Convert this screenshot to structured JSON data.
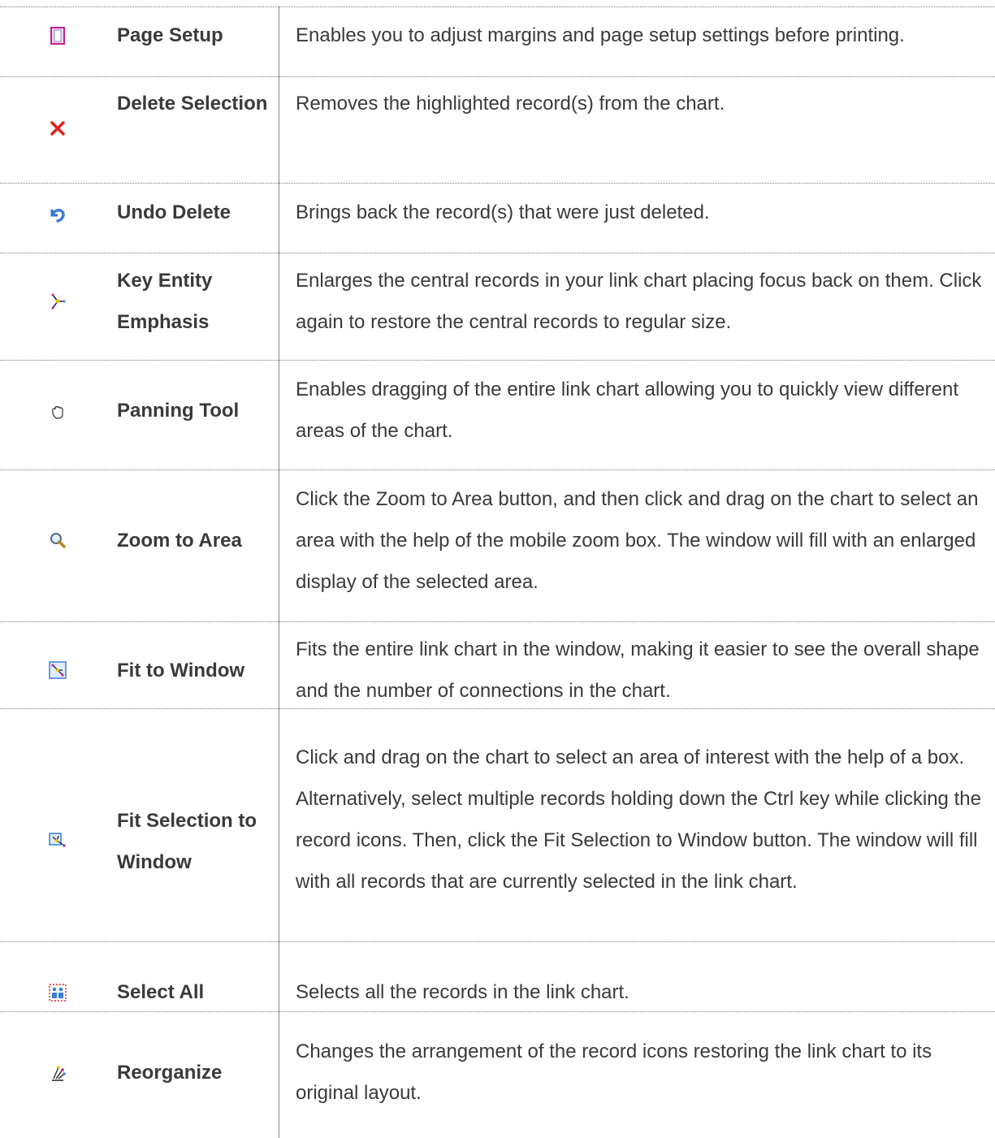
{
  "rows": [
    {
      "icon": "page-setup-icon",
      "name": "Page Setup",
      "desc": "Enables you to adjust margins and page setup settings before printing."
    },
    {
      "icon": "delete-x-icon",
      "name": "Delete Selection",
      "desc": "Removes the highlighted record(s) from the chart."
    },
    {
      "icon": "undo-arrow-icon",
      "name": "Undo Delete",
      "desc": "Brings back the record(s) that were just deleted."
    },
    {
      "icon": "key-entity-icon",
      "name": "Key Entity Emphasis",
      "desc": "Enlarges the central records in your link chart placing focus back on them. Click again to restore the central records to regular size."
    },
    {
      "icon": "hand-pan-icon",
      "name": "Panning Tool",
      "desc": "Enables dragging of the entire link chart allowing you to quickly view different areas of the chart."
    },
    {
      "icon": "zoom-magnifier-icon",
      "name": "Zoom to Area",
      "desc": "Click the Zoom to Area button, and then click and drag on the chart to select an area with the help of the mobile zoom box. The window will fill with an enlarged display of the selected area."
    },
    {
      "icon": "fit-window-icon",
      "name": "Fit to Window",
      "desc": "Fits the entire link chart in the window, making it easier to see the overall shape and the number of connections in the chart."
    },
    {
      "icon": "fit-selection-icon",
      "name": "Fit Selection to Window",
      "desc": "Click and drag on the chart to select an area of interest with the help of a box. Alternatively, select multiple records holding down the Ctrl key while clicking the record icons. Then, click the Fit Selection to Window button. The window will fill with all records that are currently selected in the link chart."
    },
    {
      "icon": "select-all-icon",
      "name": "Select All",
      "desc": "Selects all the records in the link chart."
    },
    {
      "icon": "reorganize-icon",
      "name": "Reorganize",
      "desc": "Changes the arrangement of the record icons restoring the link chart to its original layout."
    }
  ],
  "colors": {
    "delete": "#e0201c",
    "undo": "#3a7fd6",
    "accent": "#c01f8f"
  }
}
